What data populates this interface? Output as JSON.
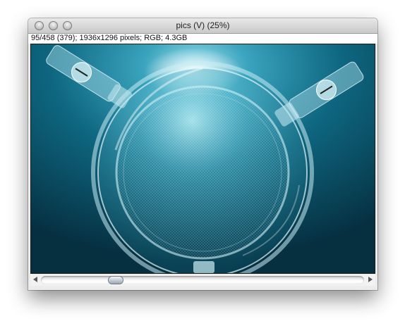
{
  "window": {
    "title": "pics (V) (25%)",
    "info": "95/458 (379); 1936x1296 pixels; RGB; 4.3GB",
    "buttons": [
      "close-icon",
      "minimize-icon",
      "zoom-icon"
    ]
  },
  "image": {
    "description_icon": "underwater-photo-icon",
    "colors": {
      "water_dark": "#07384a",
      "water_mid": "#0e6680",
      "water_light": "#5fb9cf",
      "glass": "#bfe6ee"
    }
  },
  "scrollbar": {
    "position_fraction": 0.22,
    "left_arrow": "arrow-left-icon",
    "right_arrow": "arrow-right-icon"
  }
}
